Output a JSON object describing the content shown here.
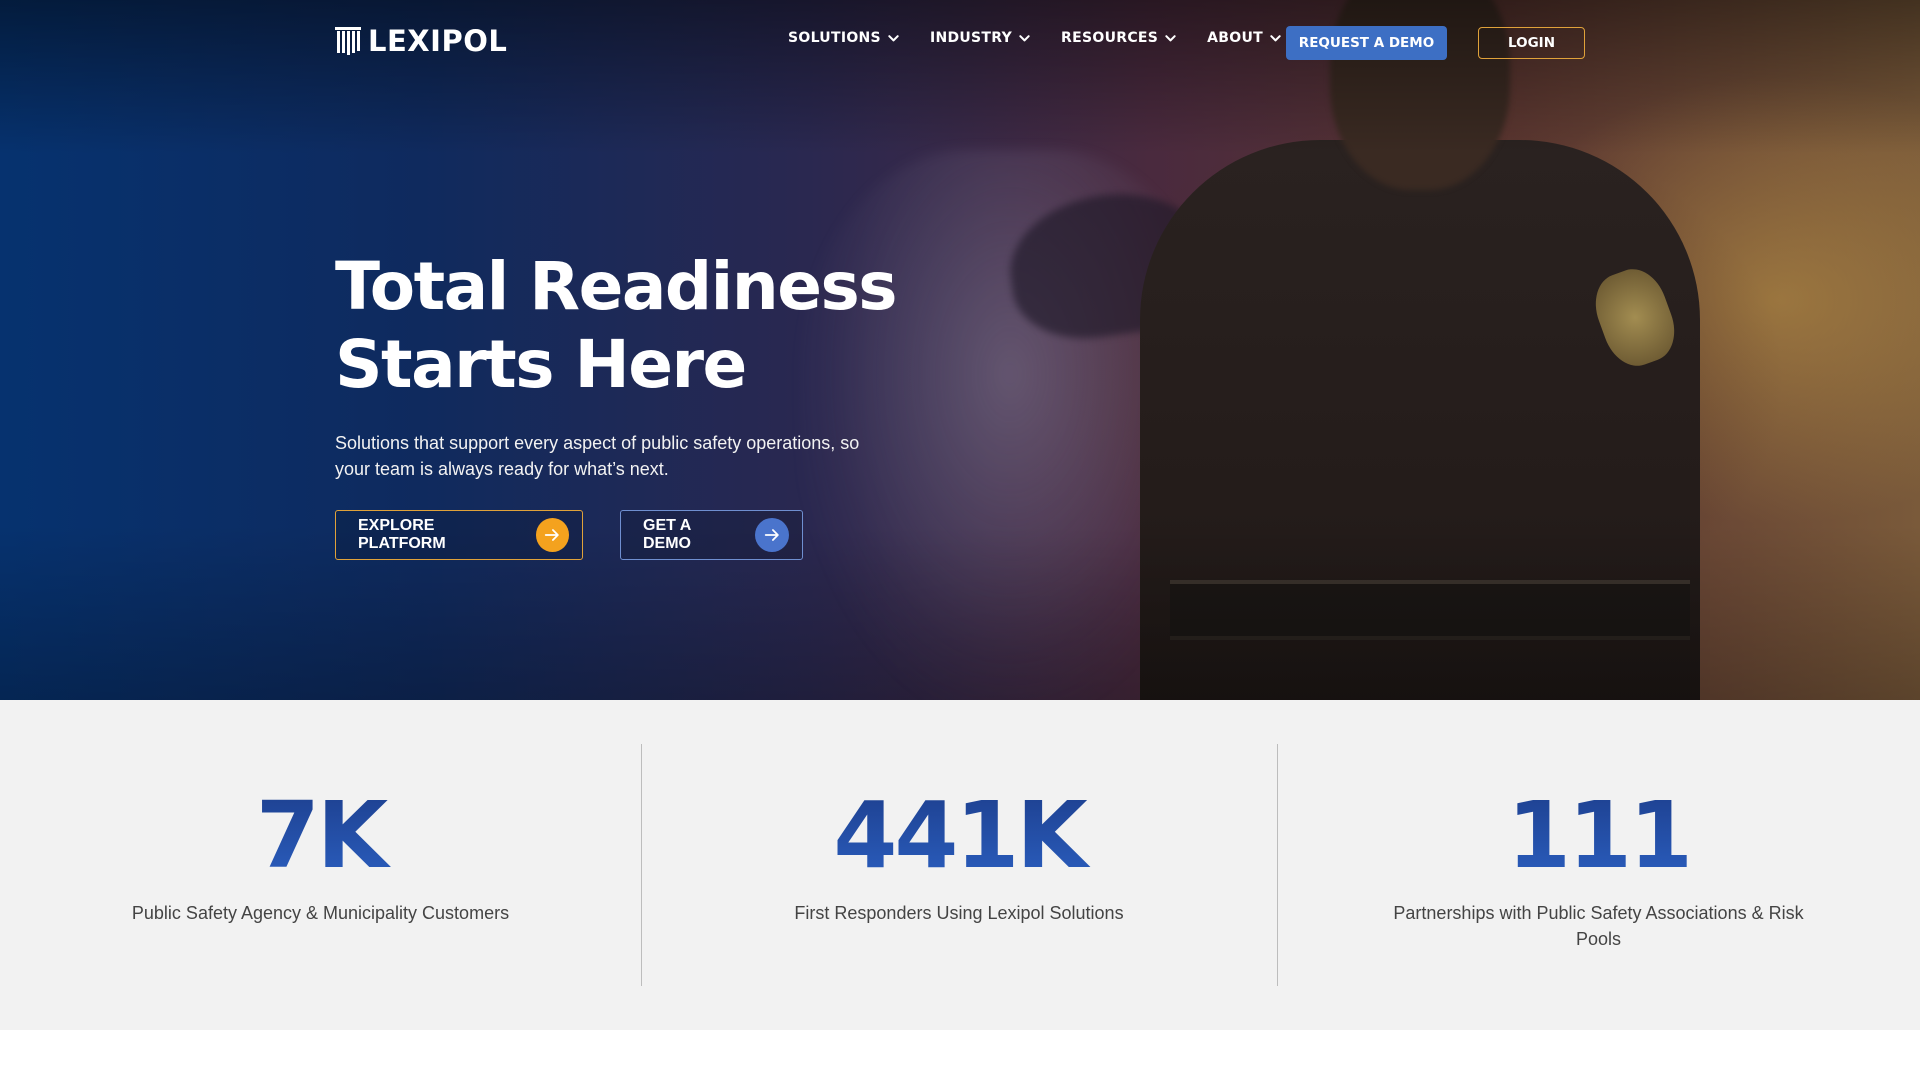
{
  "brand": {
    "name": "LEXIPOL"
  },
  "nav": {
    "items": [
      {
        "label": "SOLUTIONS"
      },
      {
        "label": "INDUSTRY"
      },
      {
        "label": "RESOURCES"
      },
      {
        "label": "ABOUT"
      }
    ],
    "request_demo_label": "REQUEST A DEMO",
    "login_label": "LOGIN"
  },
  "hero": {
    "headline_line1": "Total Readiness",
    "headline_line2": "Starts Here",
    "subtext": "Solutions that support every aspect of public safety operations, so your team is always ready for what’s next.",
    "cta_explore": "EXPLORE PLATFORM",
    "cta_demo": "GET A DEMO"
  },
  "stats": [
    {
      "value": "7K",
      "label": "Public Safety Agency & Municipality Customers"
    },
    {
      "value": "441K",
      "label": "First Responders Using Lexipol Solutions"
    },
    {
      "value": "111",
      "label": "Partnerships with Public Safety Associations & Risk Pools"
    }
  ],
  "colors": {
    "accent_blue": "#3d6fc4",
    "accent_orange": "#f4a21e",
    "stat_blue": "#1f4ea0",
    "stats_bg": "#f2f2f2"
  },
  "icons": {
    "logo": "pillar-logo-icon",
    "dropdown": "chevron-down-icon",
    "cta_arrow": "arrow-right-icon"
  }
}
